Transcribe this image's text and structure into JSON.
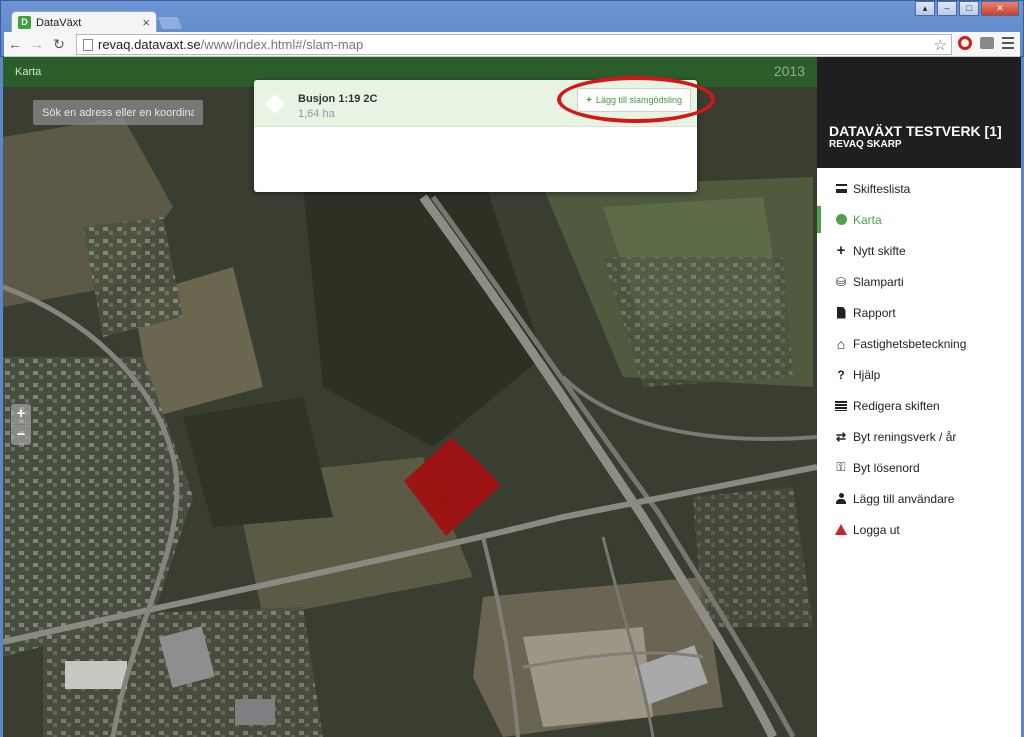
{
  "browser": {
    "tab_title": "DataVäxt",
    "tab_close": "×",
    "url_host": "revaq.datavaxt.se",
    "url_path": "/www/index.html#/slam-map"
  },
  "map": {
    "header_title": "Karta",
    "year": "2013",
    "search_placeholder": "Sök en adress eller en koordinat",
    "zoom_in": "+",
    "zoom_out": "−",
    "field_color": "#a30f0f"
  },
  "popup": {
    "field_name": "Busjon 1:19 2C",
    "field_area": "1,64 ha",
    "add_button_label": "Lägg till slamgödsling",
    "add_button_icon": "+"
  },
  "sidebar": {
    "org_title": "DATAVÄXT TESTVERK [1]",
    "plant_name": "REVAQ SKARP",
    "accent": "#4ea04e",
    "items": [
      {
        "label": "Skifteslista",
        "icon": "list-icon",
        "glyph": ""
      },
      {
        "label": "Karta",
        "icon": "globe-icon",
        "glyph": ""
      },
      {
        "label": "Nytt skifte",
        "icon": "plus-icon",
        "glyph": "+"
      },
      {
        "label": "Slamparti",
        "icon": "cubes-icon",
        "glyph": "⛁"
      },
      {
        "label": "Rapport",
        "icon": "document-icon",
        "glyph": ""
      },
      {
        "label": "Fastighetsbeteckning",
        "icon": "home-icon",
        "glyph": "⌂"
      },
      {
        "label": "Hjälp",
        "icon": "question-icon",
        "glyph": "?"
      },
      {
        "label": "Redigera skiften",
        "icon": "table-icon",
        "glyph": ""
      },
      {
        "label": "Byt reningsverk / år",
        "icon": "swap-icon",
        "glyph": "⇄"
      },
      {
        "label": "Byt lösenord",
        "icon": "key-icon",
        "glyph": "⚿"
      },
      {
        "label": "Lägg till användare",
        "icon": "user-icon",
        "glyph": ""
      },
      {
        "label": "Logga ut",
        "icon": "warning-icon",
        "glyph": ""
      }
    ]
  }
}
